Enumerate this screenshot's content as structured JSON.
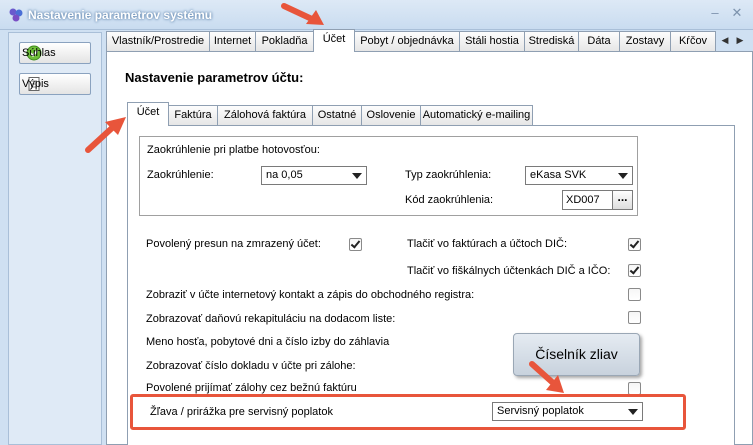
{
  "window": {
    "title": "Nastavenie parametrov systému"
  },
  "side_buttons": {
    "approve": "Súhlas",
    "print": "Výpis"
  },
  "tabs": [
    "Vlastník/Prostredie",
    "Internet",
    "Pokladňa",
    "Účet",
    "Pobyt / objednávka",
    "Stáli hostia",
    "Strediská",
    "Dáta",
    "Zostavy",
    "Kŕčov"
  ],
  "active_tab": "Účet",
  "heading": "Nastavenie parametrov účtu:",
  "subtabs": [
    "Účet",
    "Faktúra",
    "Zálohová faktúra",
    "Ostatné",
    "Oslovenie",
    "Automatický e-mailing"
  ],
  "active_subtab": "Účet",
  "rounding": {
    "group_title": "Zaokrúhlenie pri platbe hotovosťou:",
    "rounding_label": "Zaokrúhlenie:",
    "rounding_value": "na 0,05",
    "type_label": "Typ zaokrúhlenia:",
    "type_value": "eKasa SVK",
    "code_label": "Kód zaokrúhlenia:",
    "code_value": "XD007",
    "code_button": "..."
  },
  "options": {
    "frozen_transfer": {
      "label": "Povolený presun na zmrazený účet:",
      "checked": true
    },
    "print_dic_invoices": {
      "label": "Tlačiť vo faktúrach a účtoch DIČ:",
      "checked": true
    },
    "print_dic_fiscal": {
      "label": "Tlačiť vo fiškálnych účtenkách DIČ a IČO:",
      "checked": true
    },
    "show_internet_contact": {
      "label": "Zobraziť v účte internetový kontakt a zápis do obchodného registra:",
      "checked": false
    },
    "tax_recap": {
      "label": "Zobrazovať daňovú rekapituláciu na dodacom liste:",
      "checked": false
    },
    "guest_header": {
      "label": "Meno hosťa, pobytové dni a číslo izby do záhlavia",
      "checked": false
    },
    "doc_number": {
      "label": "Zobrazovať číslo dokladu v účte pri zálohe:",
      "checked": false
    },
    "allow_deposits": {
      "label": "Povolené prijímať zálohy cez bežnú faktúru",
      "checked": false
    }
  },
  "service_fee": {
    "label": "Žľava / prirážka pre servisný poplatok",
    "value": "Servisný poplatok"
  },
  "callout": {
    "text": "Číselník zliav"
  },
  "colors": {
    "annotation": "#e8553b",
    "window_bg": "#cfe0f2"
  }
}
